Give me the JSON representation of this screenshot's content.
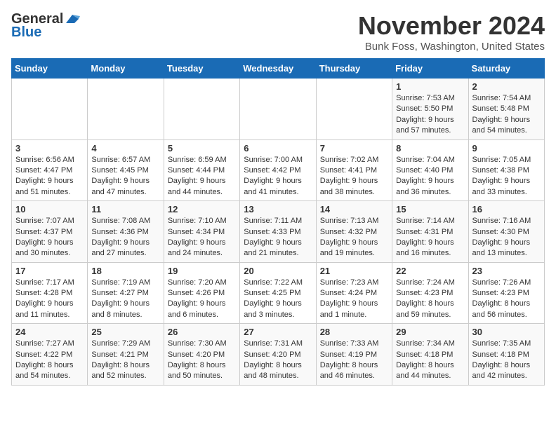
{
  "header": {
    "logo_general": "General",
    "logo_blue": "Blue",
    "month_title": "November 2024",
    "subtitle": "Bunk Foss, Washington, United States"
  },
  "days_of_week": [
    "Sunday",
    "Monday",
    "Tuesday",
    "Wednesday",
    "Thursday",
    "Friday",
    "Saturday"
  ],
  "weeks": [
    [
      {
        "day": "",
        "info": ""
      },
      {
        "day": "",
        "info": ""
      },
      {
        "day": "",
        "info": ""
      },
      {
        "day": "",
        "info": ""
      },
      {
        "day": "",
        "info": ""
      },
      {
        "day": "1",
        "info": "Sunrise: 7:53 AM\nSunset: 5:50 PM\nDaylight: 9 hours and 57 minutes."
      },
      {
        "day": "2",
        "info": "Sunrise: 7:54 AM\nSunset: 5:48 PM\nDaylight: 9 hours and 54 minutes."
      }
    ],
    [
      {
        "day": "3",
        "info": "Sunrise: 6:56 AM\nSunset: 4:47 PM\nDaylight: 9 hours and 51 minutes."
      },
      {
        "day": "4",
        "info": "Sunrise: 6:57 AM\nSunset: 4:45 PM\nDaylight: 9 hours and 47 minutes."
      },
      {
        "day": "5",
        "info": "Sunrise: 6:59 AM\nSunset: 4:44 PM\nDaylight: 9 hours and 44 minutes."
      },
      {
        "day": "6",
        "info": "Sunrise: 7:00 AM\nSunset: 4:42 PM\nDaylight: 9 hours and 41 minutes."
      },
      {
        "day": "7",
        "info": "Sunrise: 7:02 AM\nSunset: 4:41 PM\nDaylight: 9 hours and 38 minutes."
      },
      {
        "day": "8",
        "info": "Sunrise: 7:04 AM\nSunset: 4:40 PM\nDaylight: 9 hours and 36 minutes."
      },
      {
        "day": "9",
        "info": "Sunrise: 7:05 AM\nSunset: 4:38 PM\nDaylight: 9 hours and 33 minutes."
      }
    ],
    [
      {
        "day": "10",
        "info": "Sunrise: 7:07 AM\nSunset: 4:37 PM\nDaylight: 9 hours and 30 minutes."
      },
      {
        "day": "11",
        "info": "Sunrise: 7:08 AM\nSunset: 4:36 PM\nDaylight: 9 hours and 27 minutes."
      },
      {
        "day": "12",
        "info": "Sunrise: 7:10 AM\nSunset: 4:34 PM\nDaylight: 9 hours and 24 minutes."
      },
      {
        "day": "13",
        "info": "Sunrise: 7:11 AM\nSunset: 4:33 PM\nDaylight: 9 hours and 21 minutes."
      },
      {
        "day": "14",
        "info": "Sunrise: 7:13 AM\nSunset: 4:32 PM\nDaylight: 9 hours and 19 minutes."
      },
      {
        "day": "15",
        "info": "Sunrise: 7:14 AM\nSunset: 4:31 PM\nDaylight: 9 hours and 16 minutes."
      },
      {
        "day": "16",
        "info": "Sunrise: 7:16 AM\nSunset: 4:30 PM\nDaylight: 9 hours and 13 minutes."
      }
    ],
    [
      {
        "day": "17",
        "info": "Sunrise: 7:17 AM\nSunset: 4:28 PM\nDaylight: 9 hours and 11 minutes."
      },
      {
        "day": "18",
        "info": "Sunrise: 7:19 AM\nSunset: 4:27 PM\nDaylight: 9 hours and 8 minutes."
      },
      {
        "day": "19",
        "info": "Sunrise: 7:20 AM\nSunset: 4:26 PM\nDaylight: 9 hours and 6 minutes."
      },
      {
        "day": "20",
        "info": "Sunrise: 7:22 AM\nSunset: 4:25 PM\nDaylight: 9 hours and 3 minutes."
      },
      {
        "day": "21",
        "info": "Sunrise: 7:23 AM\nSunset: 4:24 PM\nDaylight: 9 hours and 1 minute."
      },
      {
        "day": "22",
        "info": "Sunrise: 7:24 AM\nSunset: 4:23 PM\nDaylight: 8 hours and 59 minutes."
      },
      {
        "day": "23",
        "info": "Sunrise: 7:26 AM\nSunset: 4:23 PM\nDaylight: 8 hours and 56 minutes."
      }
    ],
    [
      {
        "day": "24",
        "info": "Sunrise: 7:27 AM\nSunset: 4:22 PM\nDaylight: 8 hours and 54 minutes."
      },
      {
        "day": "25",
        "info": "Sunrise: 7:29 AM\nSunset: 4:21 PM\nDaylight: 8 hours and 52 minutes."
      },
      {
        "day": "26",
        "info": "Sunrise: 7:30 AM\nSunset: 4:20 PM\nDaylight: 8 hours and 50 minutes."
      },
      {
        "day": "27",
        "info": "Sunrise: 7:31 AM\nSunset: 4:20 PM\nDaylight: 8 hours and 48 minutes."
      },
      {
        "day": "28",
        "info": "Sunrise: 7:33 AM\nSunset: 4:19 PM\nDaylight: 8 hours and 46 minutes."
      },
      {
        "day": "29",
        "info": "Sunrise: 7:34 AM\nSunset: 4:18 PM\nDaylight: 8 hours and 44 minutes."
      },
      {
        "day": "30",
        "info": "Sunrise: 7:35 AM\nSunset: 4:18 PM\nDaylight: 8 hours and 42 minutes."
      }
    ]
  ]
}
